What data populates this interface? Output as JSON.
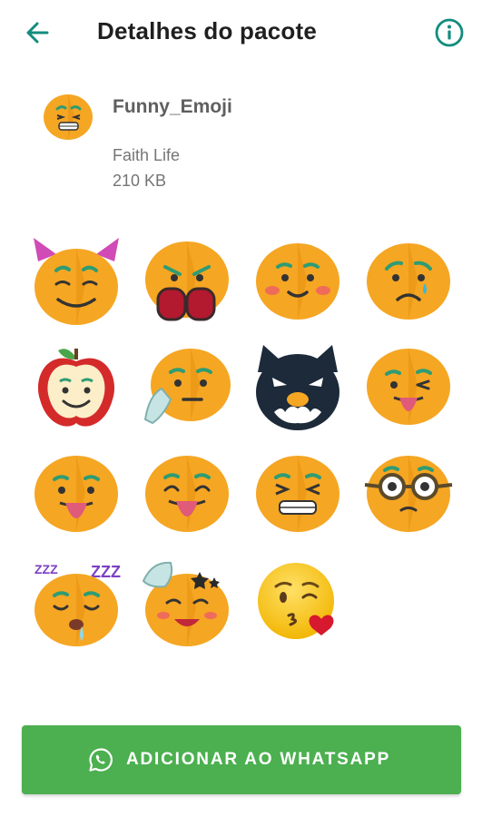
{
  "app_bar": {
    "title": "Detalhes do pacote",
    "back_icon": "arrow-left-icon",
    "info_icon": "info-circle-icon",
    "accent_color": "#128c7e"
  },
  "pack": {
    "name": "Funny_Emoji",
    "author": "Faith Life",
    "size": "210 KB"
  },
  "stickers": [
    {
      "name": "devil-horns-smirk"
    },
    {
      "name": "angry-boxing-gloves"
    },
    {
      "name": "blushing-smile"
    },
    {
      "name": "sad-tear"
    },
    {
      "name": "apple-face"
    },
    {
      "name": "thinking-bandaged-hand"
    },
    {
      "name": "batman-mask"
    },
    {
      "name": "winking-tongue-out"
    },
    {
      "name": "tongue-out"
    },
    {
      "name": "laughing-tongue-out"
    },
    {
      "name": "grimace"
    },
    {
      "name": "nerd-glasses"
    },
    {
      "name": "sleeping-zzz",
      "text": "ZZZ"
    },
    {
      "name": "dizzy-bandaged-stars"
    },
    {
      "name": "kissing-heart-emoji"
    }
  ],
  "add_button": {
    "label": "ADICIONAR AO WHATSAPP",
    "icon": "whatsapp-icon",
    "color": "#4caf50"
  }
}
